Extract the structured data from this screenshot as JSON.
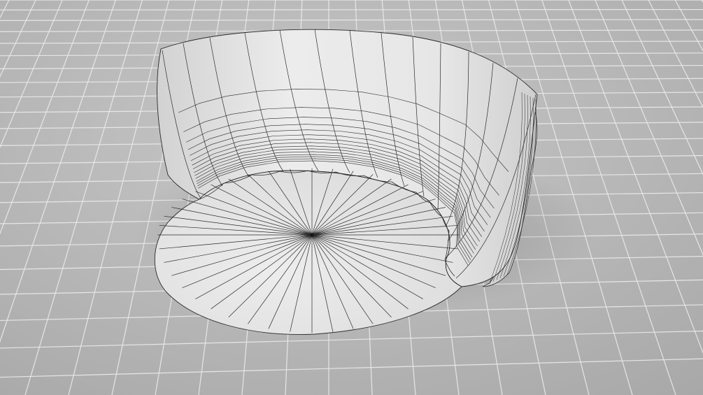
{
  "scene": {
    "object": "curved-shell-with-disc-base",
    "view": "perspective",
    "shading": "clay-with-wireframe",
    "ground": "grid-plane"
  },
  "colors": {
    "background": "#b9b9b9",
    "ground_light": "#c4c4c4",
    "ground_dark": "#a9a9a9",
    "grid_line": "#e9e9e9",
    "surface_light": "#ececec",
    "surface_mid": "#dcdcdc",
    "surface_dark": "#c6c6c6",
    "wire": "#2a2a2a",
    "shadow": "#8f8f8f"
  }
}
